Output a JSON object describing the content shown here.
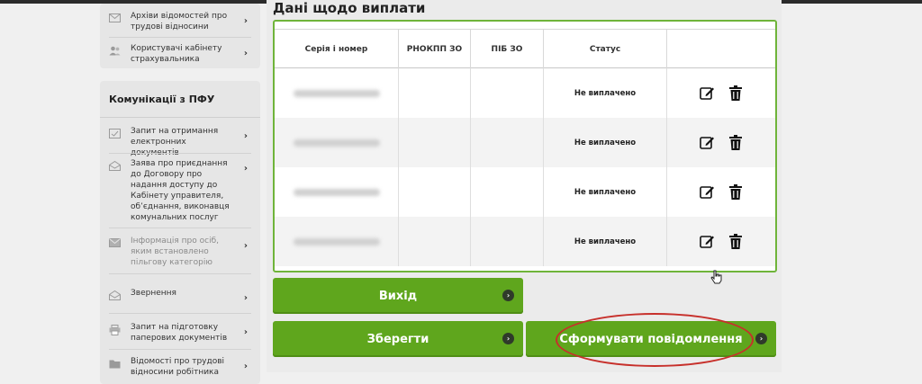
{
  "sidebar": {
    "top_items": [
      {
        "icon": "envelope-icon",
        "label": "Архіви відомостей про трудові відносини"
      },
      {
        "icon": "users-icon",
        "label": "Користувачі кабінету страхувальника"
      }
    ],
    "comm_title": "Комунікації з ПФУ",
    "comm_items": [
      {
        "icon": "document-request-icon",
        "label": "Запит на отримання електронних документів",
        "muted": false
      },
      {
        "icon": "envelope-open-icon",
        "label": "Заява про приєднання до Договору про надання доступу до Кабінету управителя, об’єднання, виконавця комунальних послуг",
        "muted": false
      },
      {
        "icon": "envelope-icon",
        "label": "Інформація про осіб, яким встановлено пільгову категорію",
        "muted": true
      },
      {
        "icon": "envelope-open-icon",
        "label": "Звернення",
        "muted": false
      },
      {
        "icon": "printer-icon",
        "label": "Запит на підготовку паперових документів",
        "muted": false
      },
      {
        "icon": "folder-icon",
        "label": "Відомості про трудові відносини робітника",
        "muted": false
      }
    ]
  },
  "main": {
    "title": "Дані щодо виплати",
    "columns": [
      "Серія і номер",
      "РНОКПП ЗО",
      "ПІБ ЗО",
      "Статус",
      ""
    ],
    "rows": [
      {
        "status": "Не виплачено"
      },
      {
        "status": "Не виплачено"
      },
      {
        "status": "Не виплачено"
      },
      {
        "status": "Не виплачено"
      }
    ],
    "buttons": {
      "exit": "Вихід",
      "save": "Зберегти",
      "generate": "Сформувати повідомлення"
    }
  },
  "colors": {
    "accent_green": "#5fa61d",
    "table_border": "#6fb43a",
    "highlight_red": "#c7302b"
  }
}
